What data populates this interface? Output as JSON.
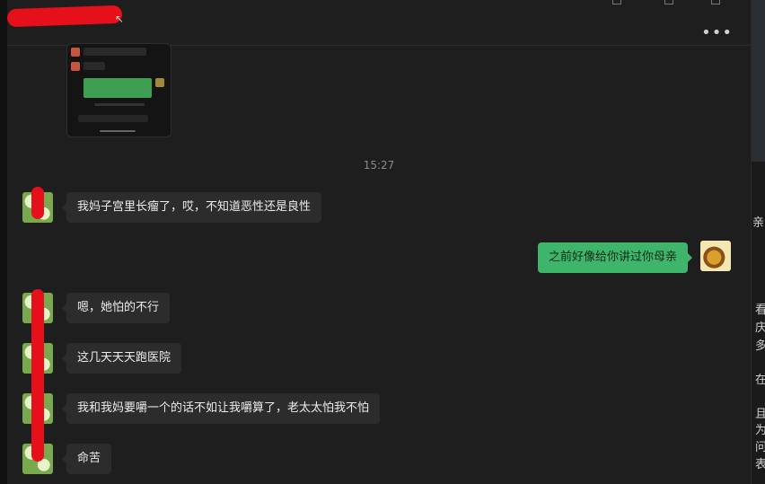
{
  "header": {
    "title_glyph": "↖",
    "more_icon": "more-horizontal-icon"
  },
  "shared_image": {
    "description_icon": "screenshot-thumbnail-icon"
  },
  "timestamp": "15:27",
  "messages": [
    {
      "side": "left",
      "text": "我妈子宫里长瘤了，哎，不知道恶性还是良性"
    },
    {
      "side": "right",
      "text": "之前好像给你讲过你母亲"
    },
    {
      "side": "left",
      "text": "嗯，她怕的不行"
    },
    {
      "side": "left",
      "text": "这几天天天跑医院"
    },
    {
      "side": "left",
      "text": "我和我妈要嚼一个的话不如让我嚼算了，老太太怕我不怕"
    },
    {
      "side": "left",
      "text": "命苦"
    }
  ],
  "side_panel": {
    "chars": [
      "亲",
      "看",
      "庆",
      "多",
      "在",
      "且",
      "为",
      "问",
      "表"
    ]
  },
  "colors": {
    "chat_bg": "#1e1e1e",
    "bubble_other": "#2c2c2c",
    "bubble_self": "#3fb56b",
    "redaction": "#e5101a"
  }
}
